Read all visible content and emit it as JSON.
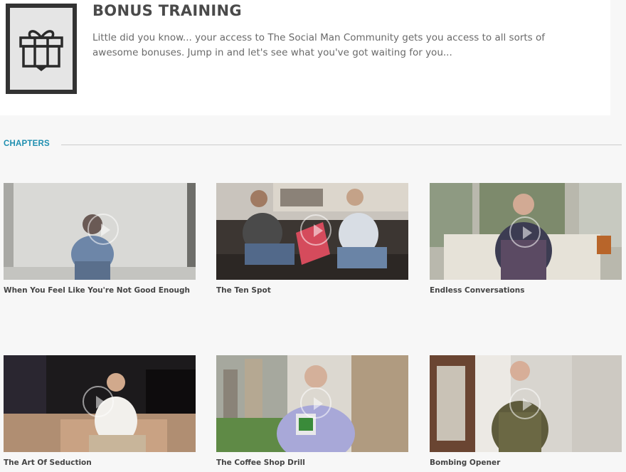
{
  "header": {
    "title": "BONUS TRAINING",
    "description": "Little did you know... your access to The Social Man Community gets you access to all sorts of awesome bonuses. Jump in and let's see what you've got waiting for you...",
    "icon": "gift-icon"
  },
  "chapters": {
    "heading": "CHAPTERS",
    "items": [
      {
        "title": "When You Feel Like You're Not Good Enough"
      },
      {
        "title": "The Ten Spot"
      },
      {
        "title": "Endless Conversations"
      },
      {
        "title": "The Art Of Seduction"
      },
      {
        "title": "The Coffee Shop Drill"
      },
      {
        "title": "Bombing Opener"
      }
    ]
  },
  "colors": {
    "accent": "#1f8fb0",
    "title": "#4a4a4a",
    "body_text": "#6a6a6a",
    "background": "#f7f7f7"
  }
}
